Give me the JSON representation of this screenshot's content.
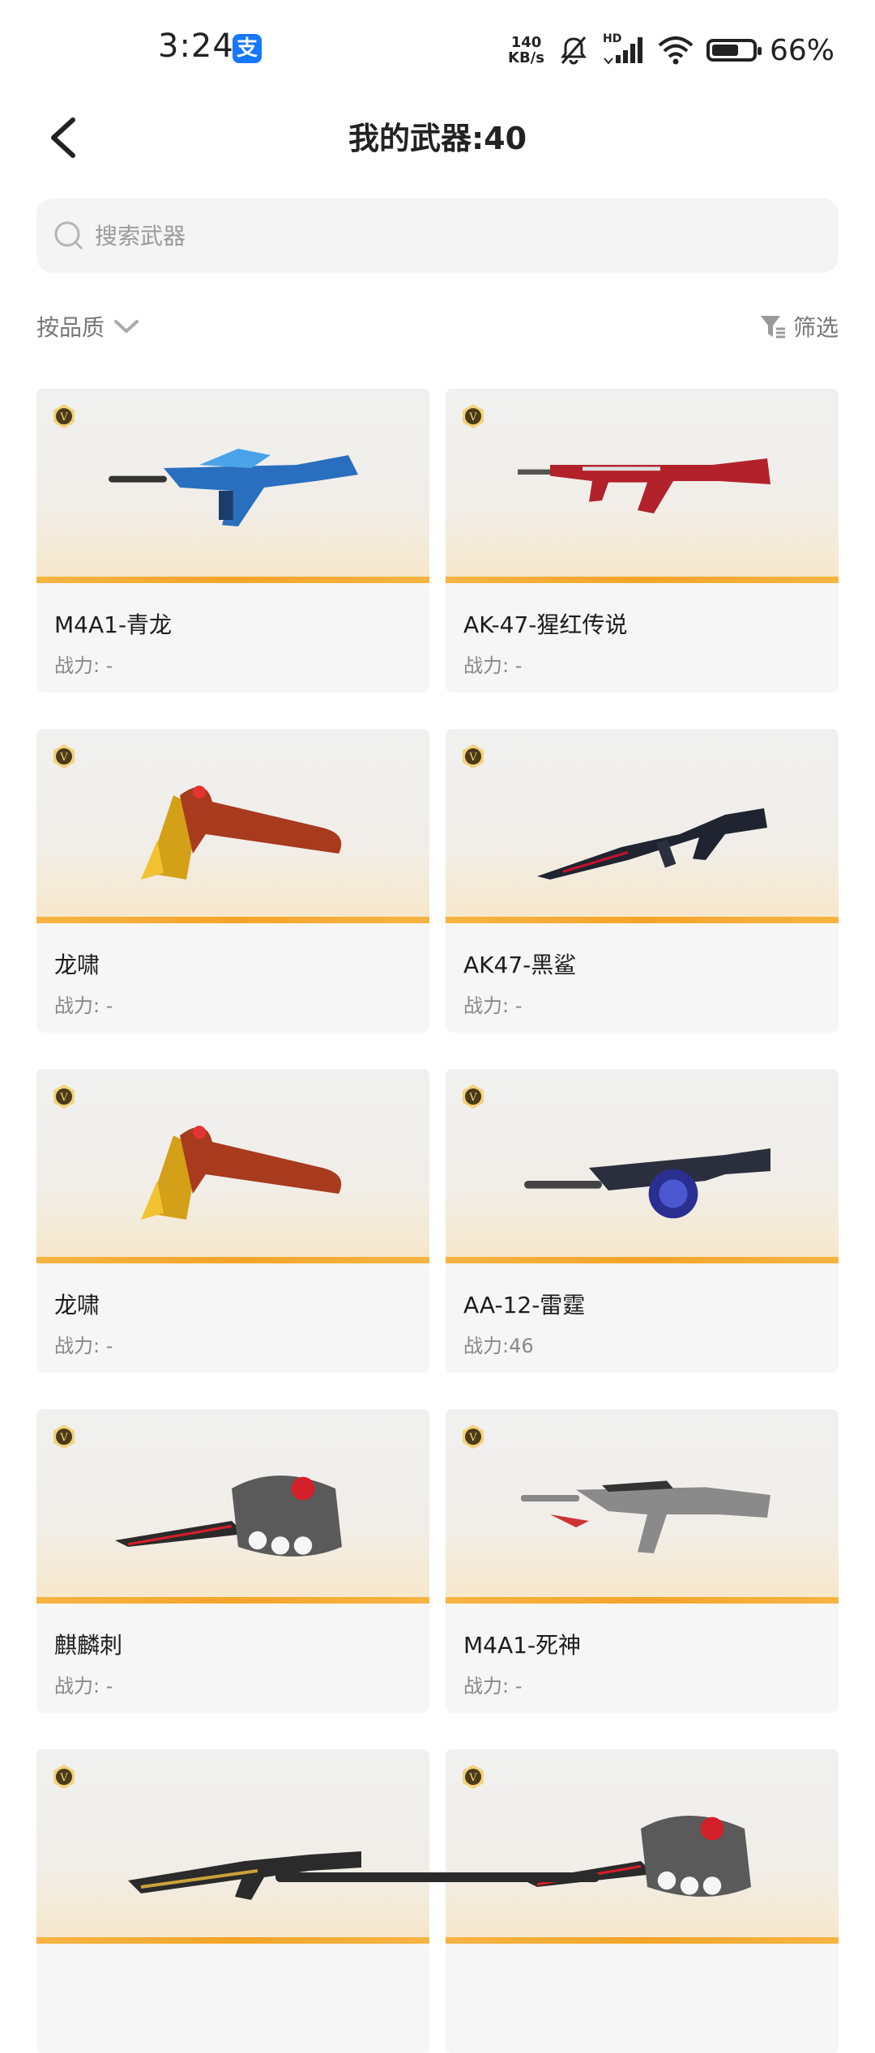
{
  "status_bar": {
    "time": "3:24",
    "alipay_glyph": "支",
    "net_speed_value": "140",
    "net_speed_unit": "KB/s",
    "hd_label": "HD",
    "battery_percent": "66%",
    "battery_level": 0.66,
    "icons": [
      "alipay-icon",
      "mute-bell-icon",
      "signal-icon",
      "wifi-icon",
      "battery-icon"
    ]
  },
  "header": {
    "title": "我的武器:40"
  },
  "search": {
    "placeholder": "搜索武器"
  },
  "toolbar": {
    "sort_label": "按品质",
    "filter_label": "筛选"
  },
  "grade_badge_letter": "V",
  "weapons": [
    {
      "name": "M4A1-青龙",
      "power": "战力: -",
      "kind": "rifle-blue"
    },
    {
      "name": "AK-47-猩红传说",
      "power": "战力: -",
      "kind": "rifle-red"
    },
    {
      "name": "龙啸",
      "power": "战力: -",
      "kind": "axe-gold"
    },
    {
      "name": "AK47-黑鲨",
      "power": "战力: -",
      "kind": "rifle-dark"
    },
    {
      "name": "龙啸",
      "power": "战力: -",
      "kind": "axe-gold"
    },
    {
      "name": "AA-12-雷霆",
      "power": "战力:46",
      "kind": "shotgun-blue"
    },
    {
      "name": "麒麟刺",
      "power": "战力: -",
      "kind": "knuckle-knife"
    },
    {
      "name": "M4A1-死神",
      "power": "战力: -",
      "kind": "rifle-silver"
    },
    {
      "name": "",
      "power": "",
      "kind": "rifle-gold"
    },
    {
      "name": "",
      "power": "",
      "kind": "knuckle-knife"
    }
  ],
  "colors": {
    "accent_orange": "#f3a42a",
    "card_bg": "#f6f6f6",
    "muted_text": "#888888",
    "alipay_blue": "#1677ff"
  }
}
